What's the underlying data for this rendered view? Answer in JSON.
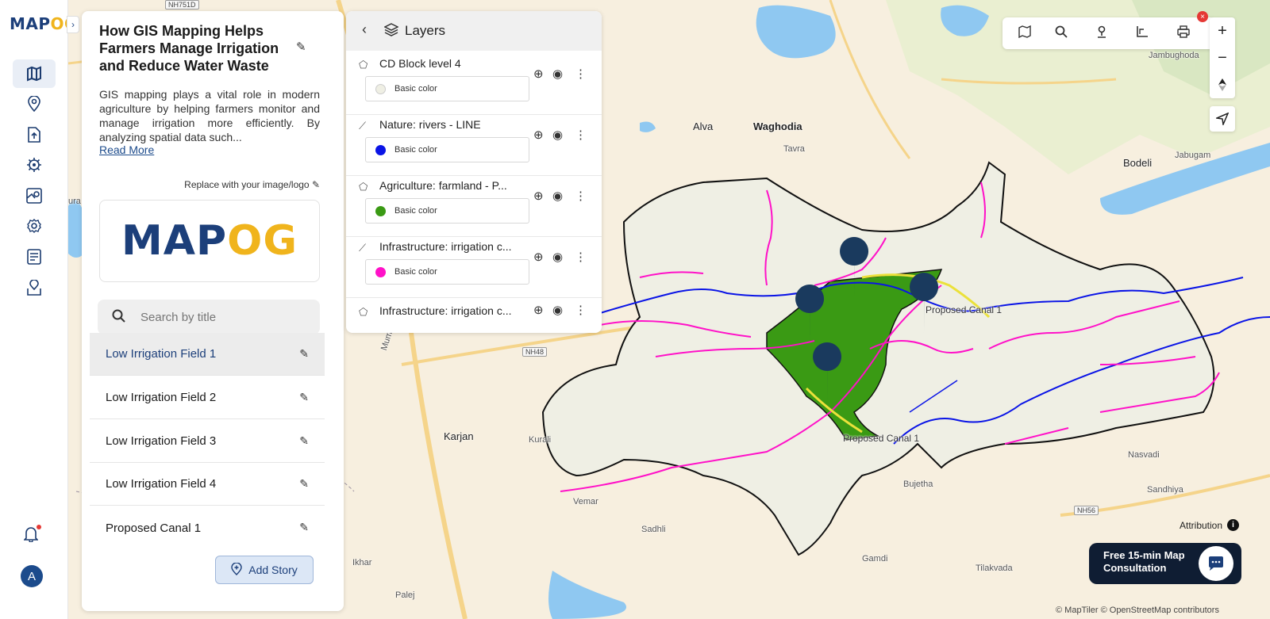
{
  "app": {
    "logo_a": "MAP",
    "logo_b": "OG",
    "collapse_icon": "chevron-right-icon"
  },
  "rail": {
    "items": [
      {
        "name": "map-icon",
        "active": true
      },
      {
        "name": "location-pin-icon"
      },
      {
        "name": "upload-file-icon"
      },
      {
        "name": "analysis-gear-icon"
      },
      {
        "name": "map-add-icon"
      },
      {
        "name": "settings-icon"
      },
      {
        "name": "report-list-icon"
      },
      {
        "name": "share-location-icon"
      }
    ],
    "user_initial": "A"
  },
  "story": {
    "title": "How GIS Mapping Helps Farmers Manage Irrigation and Reduce Water Waste",
    "description": "GIS mapping plays a vital role in modern agriculture by helping farmers monitor and manage irrigation more efficiently. By analyzing spatial data such...",
    "read_more": "Read More",
    "replace_logo": "Replace with your image/logo",
    "logo_a": "MAP",
    "logo_b": "OG",
    "search_placeholder": "Search by title",
    "items": [
      {
        "label": "Low Irrigation Field 1",
        "active": true
      },
      {
        "label": "Low Irrigation Field 2"
      },
      {
        "label": "Low Irrigation Field 3"
      },
      {
        "label": "Low Irrigation Field 4"
      },
      {
        "label": "Proposed Canal 1"
      }
    ],
    "add_story": "Add Story"
  },
  "layers": {
    "title": "Layers",
    "list": [
      {
        "name": "CD Block level 4",
        "color_label": "Basic color",
        "color": "#efefe4"
      },
      {
        "name": "Nature: rivers - LINE",
        "color_label": "Basic color",
        "color": "#0a14e6"
      },
      {
        "name": "Agriculture: farmland - P...",
        "color_label": "Basic color",
        "color": "#3a9a14"
      },
      {
        "name": "Infrastructure: irrigation c...",
        "color_label": "Basic color",
        "color": "#ff11c8"
      },
      {
        "name": "Infrastructure: irrigation c...",
        "color_label": "",
        "color": ""
      }
    ]
  },
  "map": {
    "labels": {
      "alva": "Alva",
      "waghodia": "Waghodia",
      "tavra": "Tavra",
      "bodeli": "Bodeli",
      "jabugam": "Jabugam",
      "jambughoda": "Jambughoda",
      "karjan": "Karjan",
      "kurali": "Kurali",
      "vemar": "Vemar",
      "sadhli": "Sadhli",
      "ikhar": "Ikhar",
      "palej": "Palej",
      "bujetha": "Bujetha",
      "gamdi": "Gamdi",
      "tilakvada": "Tilakvada",
      "nasvadi": "Nasvadi",
      "sandhiya": "Sandhiya",
      "ura": "ura",
      "mumbai_vadodara": "Mumbai-Vado",
      "canal_1": "Proposed Canal 1",
      "canal_2": "Proposed Canal 1"
    },
    "roads": {
      "nh48": "NH48",
      "nh56": "NH56",
      "nh751d": "NH751D"
    },
    "attribution": "Attribution",
    "credits": "© MapTiler © OpenStreetMap contributors"
  },
  "consult": {
    "text": "Free 15-min Map Consultation"
  },
  "colors": {
    "brand_navy": "#1c3f7a",
    "brand_yellow": "#f0b41c",
    "river": "#0a14e6",
    "canal": "#ff11c8",
    "farmland": "#3a9a14",
    "block": "#efefe4"
  }
}
